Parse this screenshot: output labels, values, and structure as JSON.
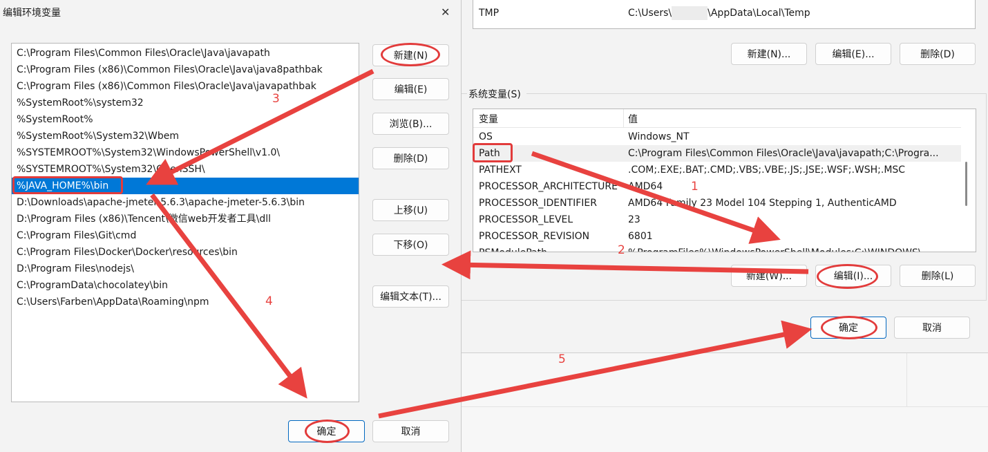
{
  "edit_dialog": {
    "title": "编辑环境变量",
    "close_glyph": "✕",
    "path_entries": [
      "C:\\Program Files\\Common Files\\Oracle\\Java\\javapath",
      "C:\\Program Files (x86)\\Common Files\\Oracle\\Java\\java8pathbak",
      "C:\\Program Files (x86)\\Common Files\\Oracle\\Java\\javapathbak",
      "%SystemRoot%\\system32",
      "%SystemRoot%",
      "%SystemRoot%\\System32\\Wbem",
      "%SYSTEMROOT%\\System32\\WindowsPowerShell\\v1.0\\",
      "%SYSTEMROOT%\\System32\\OpenSSH\\",
      "%JAVA_HOME%\\bin",
      "D:\\Downloads\\apache-jmeter-5.6.3\\apache-jmeter-5.6.3\\bin",
      "D:\\Program Files (x86)\\Tencent\\微信web开发者工具\\dll",
      "C:\\Program Files\\Git\\cmd",
      "C:\\Program Files\\Docker\\Docker\\resources\\bin",
      "D:\\Program Files\\nodejs\\",
      "C:\\ProgramData\\chocolatey\\bin",
      "C:\\Users\\Farben\\AppData\\Roaming\\npm"
    ],
    "selected_entry": "%JAVA_HOME%\\bin",
    "buttons": {
      "new": "新建(N)",
      "edit": "编辑(E)",
      "browse": "浏览(B)...",
      "delete": "删除(D)",
      "move_up": "上移(U)",
      "move_down": "下移(O)",
      "edit_text": "编辑文本(T)...",
      "ok": "确定",
      "cancel": "取消"
    }
  },
  "env_dialog": {
    "user_vars_partial": [
      {
        "name": "TMP",
        "value_prefix": "C:\\Users\\",
        "value_suffix": "\\AppData\\Local\\Temp"
      }
    ],
    "user_buttons": {
      "new": "新建(N)...",
      "edit": "编辑(E)...",
      "delete": "删除(D)"
    },
    "system_section_label": "系统变量(S)",
    "system_columns": {
      "name": "变量",
      "value": "值"
    },
    "system_vars": [
      {
        "name": "OS",
        "value": "Windows_NT"
      },
      {
        "name": "Path",
        "value": "C:\\Program Files\\Common Files\\Oracle\\Java\\javapath;C:\\Progra..."
      },
      {
        "name": "PATHEXT",
        "value": ".COM;.EXE;.BAT;.CMD;.VBS;.VBE;.JS;.JSE;.WSF;.WSH;.MSC"
      },
      {
        "name": "PROCESSOR_ARCHITECTURE",
        "value": "AMD64"
      },
      {
        "name": "PROCESSOR_IDENTIFIER",
        "value": "AMD64 Family 23 Model 104 Stepping 1, AuthenticAMD"
      },
      {
        "name": "PROCESSOR_LEVEL",
        "value": "23"
      },
      {
        "name": "PROCESSOR_REVISION",
        "value": "6801"
      },
      {
        "name": "PSModulePath",
        "value": "%ProgramFiles%\\WindowsPowerShell\\Modules;C:\\WINDOWS\\..."
      }
    ],
    "system_buttons": {
      "new": "新建(W)...",
      "edit": "编辑(I)...",
      "delete": "删除(L)"
    },
    "ok": "确定",
    "cancel": "取消"
  },
  "annotations": {
    "step_numbers": [
      "1",
      "2",
      "3",
      "4",
      "5"
    ],
    "color": "#e8423f"
  }
}
